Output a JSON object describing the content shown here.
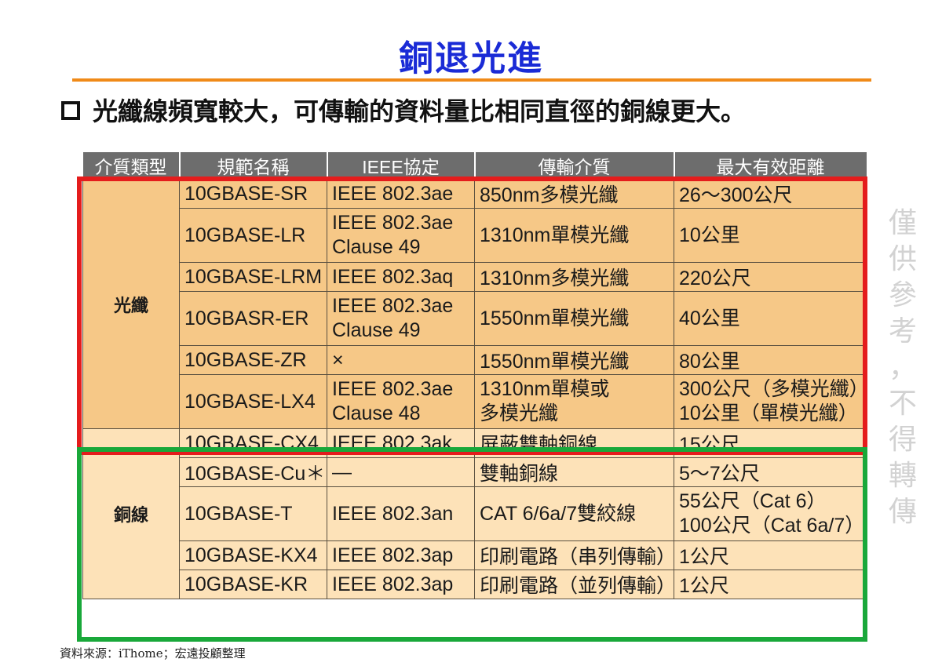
{
  "title": "銅退光進",
  "bullet_text": "光纖線頻寬較大，可傳輸的資料量比相同直徑的銅線更大。",
  "table": {
    "headers": [
      "介質類型",
      "規範名稱",
      "IEEE協定",
      "傳輸介質",
      "最大有效距離"
    ],
    "fiber_label": "光纖",
    "copper_label": "銅線",
    "fiber_rows": [
      {
        "name": "10GBASE-SR",
        "ieee": [
          "IEEE 802.3ae"
        ],
        "medium": [
          "850nm多模光纖"
        ],
        "distance": [
          "26～300公尺"
        ]
      },
      {
        "name": "10GBASE-LR",
        "ieee": [
          "IEEE 802.3ae",
          "Clause 49"
        ],
        "medium": [
          "1310nm單模光纖"
        ],
        "distance": [
          "10公里"
        ]
      },
      {
        "name": "10GBASE-LRM",
        "ieee": [
          "IEEE 802.3aq"
        ],
        "medium": [
          "1310nm多模光纖"
        ],
        "distance": [
          "220公尺"
        ]
      },
      {
        "name": "10GBASR-ER",
        "ieee": [
          "IEEE 802.3ae",
          "Clause 49"
        ],
        "medium": [
          "1550nm單模光纖"
        ],
        "distance": [
          "40公里"
        ]
      },
      {
        "name": "10GBASE-ZR",
        "ieee": [
          "×"
        ],
        "medium": [
          "1550nm單模光纖"
        ],
        "distance": [
          "80公里"
        ]
      },
      {
        "name": "10GBASE-LX4",
        "ieee": [
          "IEEE 802.3ae",
          "Clause 48"
        ],
        "medium": [
          "1310nm單模或",
          "多模光纖"
        ],
        "distance": [
          "300公尺（多模光纖）",
          "10公里（單模光纖）"
        ]
      }
    ],
    "copper_rows": [
      {
        "name": "10GBASE-CX4",
        "ieee": [
          "IEEE 802.3ak"
        ],
        "medium": [
          "屏蔽雙軸銅線"
        ],
        "distance": [
          "15公尺"
        ]
      },
      {
        "name": "10GBASE-Cu＊",
        "ieee": [
          "—"
        ],
        "medium": [
          "雙軸銅線"
        ],
        "distance": [
          "5～7公尺"
        ]
      },
      {
        "name": "10GBASE-T",
        "ieee": [
          "IEEE 802.3an"
        ],
        "medium": [
          "CAT 6/6a/7雙絞線"
        ],
        "distance": [
          "55公尺（Cat 6）",
          "100公尺（Cat 6a/7）"
        ]
      },
      {
        "name": "10GBASE-KX4",
        "ieee": [
          "IEEE 802.3ap"
        ],
        "medium": [
          "印刷電路（串列傳輸）"
        ],
        "distance": [
          "1公尺"
        ]
      },
      {
        "name": "10GBASE-KR",
        "ieee": [
          "IEEE 802.3ap"
        ],
        "medium": [
          "印刷電路（並列傳輸）"
        ],
        "distance": [
          "1公尺"
        ]
      }
    ]
  },
  "watermark": [
    "僅",
    "供",
    "參",
    "考",
    "，",
    "不",
    "得",
    "轉",
    "傳"
  ],
  "source": "資料來源：iThome；宏遠投顧整理",
  "colors": {
    "title": "#1a2bd6",
    "rule": "#f08a18",
    "header_bg": "#6d6d6d",
    "fiber_bg": "#f6c887",
    "copper_bg": "#fde2b8",
    "fiber_border": "#e41c1c",
    "copper_border": "#19a83a"
  }
}
